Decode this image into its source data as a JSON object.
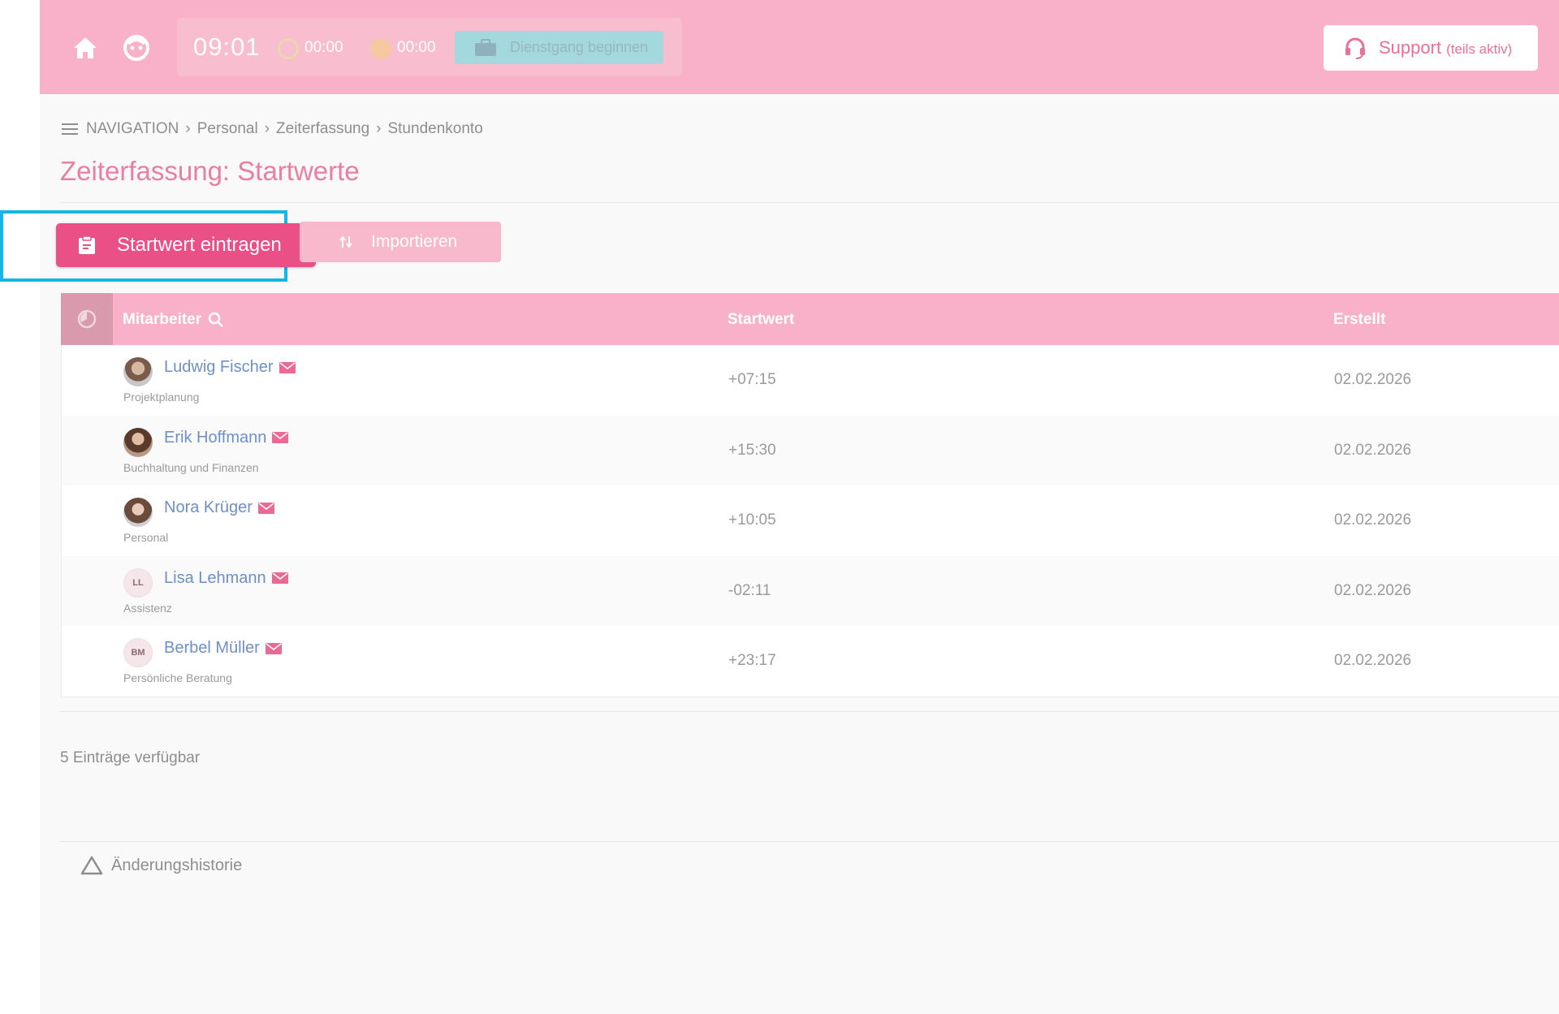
{
  "topbar": {
    "clock": "09:01",
    "timer_work": "00:00",
    "timer_break": "00:00",
    "dienstgang_label": "Dienstgang beginnen",
    "support_label": "Support",
    "support_status": "(teils aktiv)"
  },
  "breadcrumb": {
    "items": [
      "NAVIGATION",
      "Personal",
      "Zeiterfassung",
      "Stundenkonto"
    ]
  },
  "page": {
    "title": "Zeiterfassung: Startwerte"
  },
  "actions": {
    "primary_label": "Startwert eintragen",
    "import_label": "Importieren"
  },
  "table": {
    "columns": [
      "Mitarbeiter",
      "Startwert",
      "Erstellt"
    ],
    "rows": [
      {
        "name": "Ludwig Fischer",
        "dept": "Projektplanung",
        "value": "+07:15",
        "date": "02.02.2026"
      },
      {
        "name": "Erik Hoffmann",
        "dept": "Buchhaltung und Finanzen",
        "value": "+15:30",
        "date": "02.02.2026"
      },
      {
        "name": "Nora Krüger",
        "dept": "Personal",
        "value": "+10:05",
        "date": "02.02.2026"
      },
      {
        "name": "Lisa Lehmann",
        "initials": "LL",
        "dept": "Assistenz",
        "value": "-02:11",
        "date": "02.02.2026"
      },
      {
        "name": "Berbel Müller",
        "initials": "BM",
        "dept": "Persönliche Beratung",
        "value": "+23:17",
        "date": "02.02.2026"
      }
    ]
  },
  "footer": {
    "count_text": "5 Einträge verfügbar",
    "history_label": "Änderungshistorie"
  },
  "colors": {
    "brand_pink": "#f8b1c8",
    "primary_button": "#ea4f86",
    "link_blue": "#6f8fc7",
    "highlight": "#17b4e6"
  }
}
